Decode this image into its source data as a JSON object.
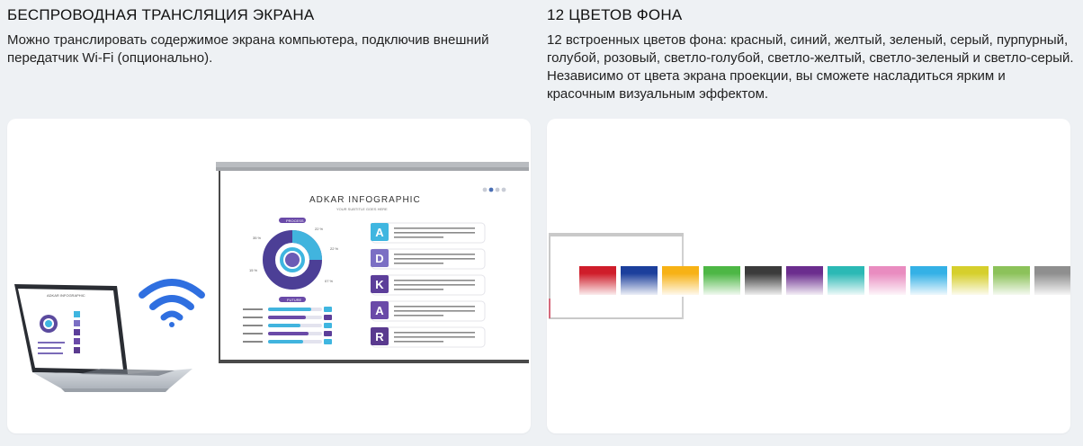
{
  "left": {
    "title": "БЕСПРОВОДНАЯ ТРАНСЛЯЦИЯ ЭКРАНА",
    "description": "Можно транслировать содержимое экрана компьютера, подключив внешний передатчик Wi-Fi (опционально)."
  },
  "right": {
    "title": "12 ЦВЕТОВ ФОНА",
    "description": "12 встроенных цветов фона: красный, синий, желтый, зеленый, серый, пурпурный, голубой, розовый, светло-голубой, светло-желтый, светло-зеленый и светло-серый. Независимо от цвета экрана проекции, вы сможете насладиться ярким и красочным визуальным эффектом."
  },
  "projection": {
    "title": "ADKAR INFOGRAPHIC",
    "subtitle": "YOUR SUBTITLE GOES HERE",
    "letters": [
      "A",
      "D",
      "K",
      "A",
      "R"
    ],
    "letter_colors": [
      "#3fb6e0",
      "#7b6fc4",
      "#5c3e9a",
      "#6a4aa8",
      "#5a3a8f"
    ],
    "section_process": "PROCESS",
    "section_future": "FUTURE",
    "bar_levels": [
      0.8,
      0.7,
      0.6,
      0.75,
      0.65
    ]
  },
  "swatches": [
    {
      "name": "red",
      "color": "#cf1d2a"
    },
    {
      "name": "blue",
      "color": "#1c3f9c"
    },
    {
      "name": "yellow",
      "color": "#f7b215"
    },
    {
      "name": "green",
      "color": "#4db745"
    },
    {
      "name": "gray",
      "color": "#3b3b3b"
    },
    {
      "name": "purple",
      "color": "#6b2d8e"
    },
    {
      "name": "cyan",
      "color": "#2bb9b5"
    },
    {
      "name": "pink",
      "color": "#e98cc0"
    },
    {
      "name": "light-blue",
      "color": "#34b1e6"
    },
    {
      "name": "light-yellow",
      "color": "#d6cf2c"
    },
    {
      "name": "light-green",
      "color": "#8cc25a"
    },
    {
      "name": "light-gray",
      "color": "#8f8f8f"
    }
  ]
}
